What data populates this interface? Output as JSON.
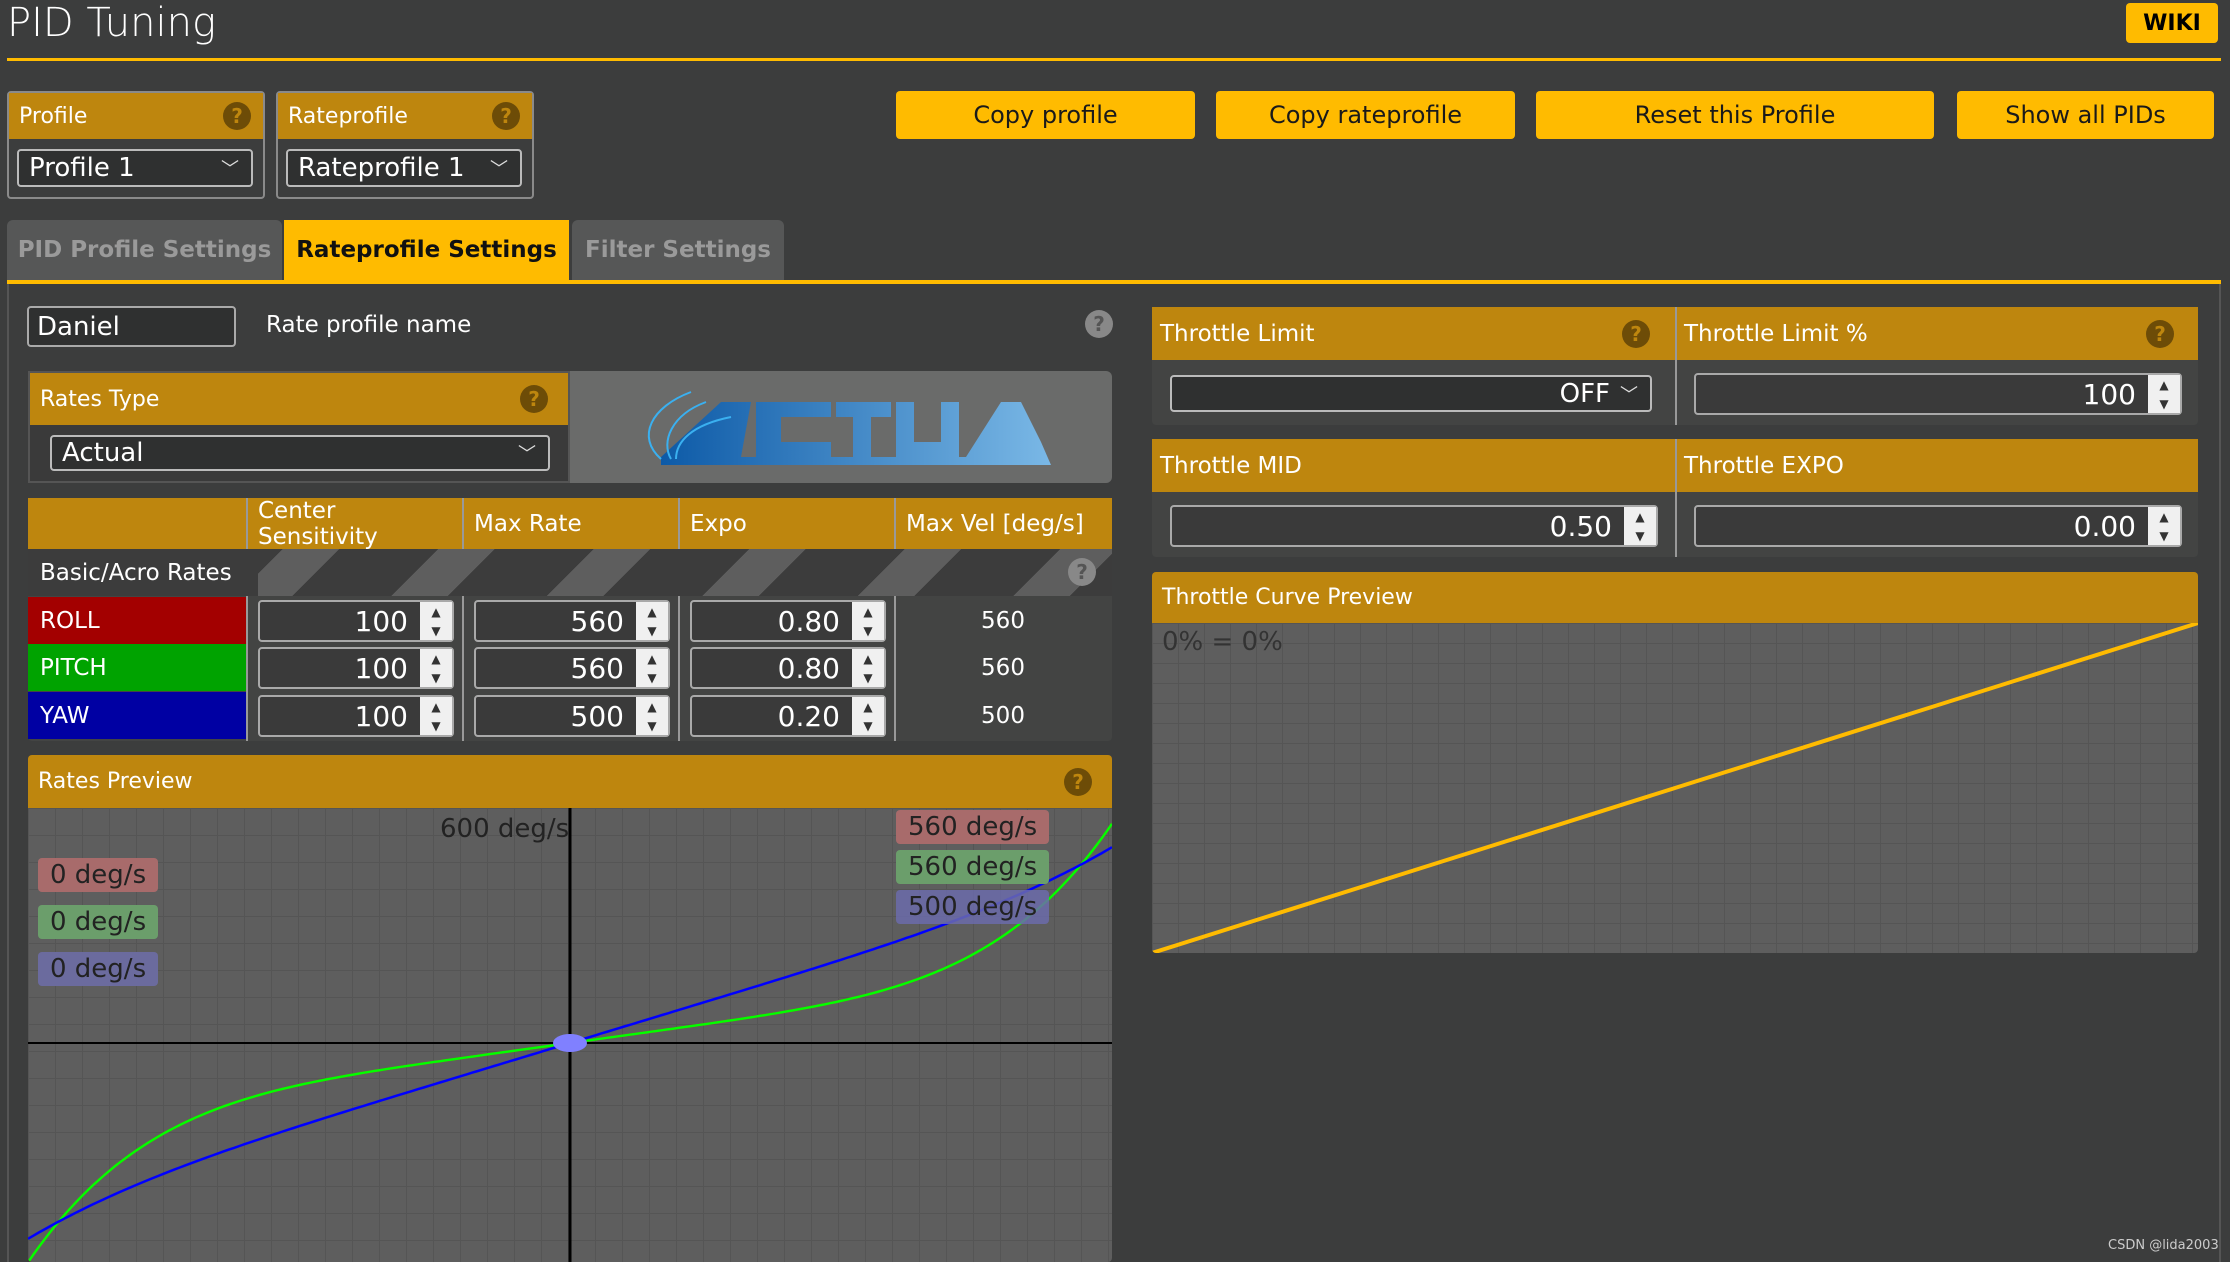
{
  "page": {
    "title": "PID Tuning",
    "wiki": "WIKI",
    "watermark": "CSDN @lida2003"
  },
  "profile": {
    "label": "Profile",
    "value": "Profile 1"
  },
  "rateprofile": {
    "label": "Rateprofile",
    "value": "Rateprofile 1"
  },
  "buttons": {
    "copy_profile": "Copy profile",
    "copy_rateprofile": "Copy rateprofile",
    "reset": "Reset this Profile",
    "show_all": "Show all PIDs"
  },
  "tabs": [
    {
      "label": "PID Profile Settings"
    },
    {
      "label": "Rateprofile Settings",
      "active": true
    },
    {
      "label": "Filter Settings"
    }
  ],
  "rate_name": {
    "value": "Daniel",
    "label": "Rate profile name"
  },
  "rates_type": {
    "label": "Rates Type",
    "value": "Actual",
    "logo": "ACTUAL"
  },
  "rates_table": {
    "headers": [
      "",
      "Center Sensitivity",
      "Max Rate",
      "Expo",
      "Max Vel [deg/s]"
    ],
    "section": "Basic/Acro Rates",
    "rows": [
      {
        "axis": "ROLL",
        "color": "#a30000",
        "center": "100",
        "max": "560",
        "expo": "0.80",
        "maxvel": "560"
      },
      {
        "axis": "PITCH",
        "color": "#00a300",
        "center": "100",
        "max": "560",
        "expo": "0.80",
        "maxvel": "560"
      },
      {
        "axis": "YAW",
        "color": "#0000a3",
        "center": "100",
        "max": "500",
        "expo": "0.20",
        "maxvel": "500"
      }
    ]
  },
  "rates_preview": {
    "title": "Rates Preview",
    "top_label": "600 deg/s",
    "current": [
      "0 deg/s",
      "0 deg/s",
      "0 deg/s"
    ],
    "max": [
      "560 deg/s",
      "560 deg/s",
      "500 deg/s"
    ],
    "line_colors": [
      "#ff0000",
      "#00ff00",
      "#0000ff"
    ]
  },
  "throttle": {
    "limit_label": "Throttle Limit",
    "limit_value": "OFF",
    "limit_pct_label": "Throttle Limit %",
    "limit_pct_value": "100",
    "mid_label": "Throttle MID",
    "mid_value": "0.50",
    "expo_label": "Throttle EXPO",
    "expo_value": "0.00",
    "curve_title": "Throttle Curve Preview",
    "curve_label": "0% = 0%",
    "curve_color": "#ffbb00"
  },
  "chart_data": [
    {
      "type": "line",
      "title": "Rates Preview",
      "series": [
        {
          "name": "ROLL",
          "center": 100,
          "max_rate": 560,
          "expo": 0.8
        },
        {
          "name": "PITCH",
          "center": 100,
          "max_rate": 560,
          "expo": 0.8
        },
        {
          "name": "YAW",
          "center": 100,
          "max_rate": 500,
          "expo": 0.2
        }
      ],
      "ylim_top": 600
    },
    {
      "type": "line",
      "title": "Throttle Curve Preview",
      "x": [
        0,
        100
      ],
      "y": [
        0,
        100
      ]
    }
  ]
}
